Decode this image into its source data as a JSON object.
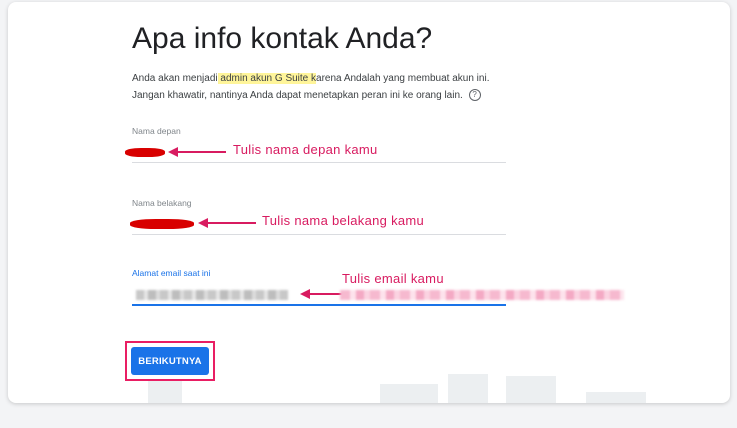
{
  "form": {
    "title": "Apa info kontak Anda?",
    "desc_part1": "Anda akan menjadi",
    "desc_highlight1": " admin akun G Suite k",
    "desc_part2": "arena Andalah yang membuat akun ini.",
    "desc_line2": "Jangan khawatir, nantinya Anda dapat menetapkan peran ini ke orang lain.",
    "help_icon_glyph": "?",
    "first_name_label": "Nama depan",
    "last_name_label": "Nama belakang",
    "email_label": "Alamat email saat ini",
    "next_button_label": "BERIKUTNYA"
  },
  "annotations": {
    "first_name": "Tulis nama depan kamu",
    "last_name": "Tulis nama belakang kamu",
    "email": "Tulis email kamu",
    "color": "#d81b60"
  },
  "colors": {
    "accent": "#1a73e8",
    "highlight": "#fff59a",
    "redaction": "#d80000",
    "button_frame": "#e91e63"
  },
  "icons": {
    "help": "help-circle-icon",
    "arrow": "arrow-left-icon"
  }
}
